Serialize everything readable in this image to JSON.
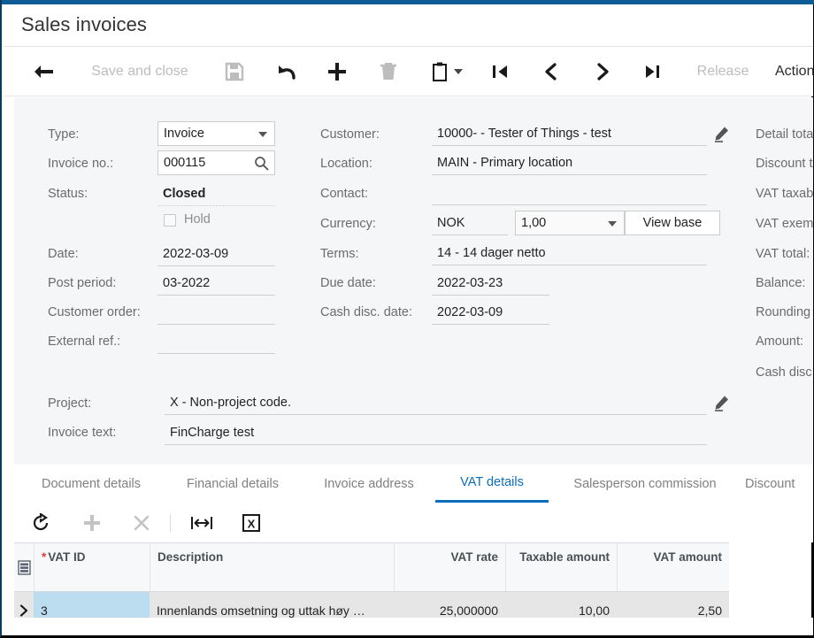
{
  "window": {
    "page_title": "Sales invoices",
    "accent_color": "#0a6ebd",
    "topbar_color": "#0f5b96"
  },
  "toolbar": {
    "back_icon": "back-arrow-icon",
    "save_and_close_label": "Save and close",
    "save_icon": "save-icon",
    "undo_icon": "undo-icon",
    "add_icon": "plus-icon",
    "delete_icon": "trash-icon",
    "clipboard_icon": "clipboard-icon",
    "first_icon": "first-record-icon",
    "prev_icon": "previous-record-icon",
    "next_icon": "next-record-icon",
    "last_icon": "last-record-icon",
    "release_label": "Release",
    "actions_label": "Actions"
  },
  "form": {
    "left": {
      "type_label": "Type:",
      "type_value": "Invoice",
      "invoice_no_label": "Invoice no.:",
      "invoice_no_value": "000115",
      "status_label": "Status:",
      "status_value": "Closed",
      "hold_label": "Hold",
      "date_label": "Date:",
      "date_value": "2022-03-09",
      "post_period_label": "Post period:",
      "post_period_value": "03-2022",
      "customer_order_label": "Customer order:",
      "customer_order_value": "",
      "external_ref_label": "External ref.:",
      "external_ref_value": ""
    },
    "middle": {
      "customer_label": "Customer:",
      "customer_value": "10000- - Tester of Things - test",
      "location_label": "Location:",
      "location_value": "MAIN - Primary location",
      "contact_label": "Contact:",
      "contact_value": "",
      "currency_label": "Currency:",
      "currency_value": "NOK",
      "rate_value": "1,00",
      "view_base_label": "View base",
      "terms_label": "Terms:",
      "terms_value": "14 - 14 dager netto",
      "due_date_label": "Due date:",
      "due_date_value": "2022-03-23",
      "cash_disc_date_label": "Cash disc. date:",
      "cash_disc_date_value": "2022-03-09"
    },
    "right": {
      "detail_total_label": "Detail tota",
      "discount_total_label": "Discount t",
      "vat_taxable_label": "VAT taxab",
      "vat_exempt_label": "VAT exem",
      "vat_total_label": "VAT total:",
      "balance_label": "Balance:",
      "rounding_label": "Rounding",
      "amount_label": "Amount:",
      "cash_disc_label": "Cash disc"
    },
    "bottom": {
      "project_label": "Project:",
      "project_value": "X - Non-project code.",
      "invoice_text_label": "Invoice text:",
      "invoice_text_value": "FinCharge test"
    }
  },
  "tabs": [
    {
      "label": "Document details",
      "active": false
    },
    {
      "label": "Financial details",
      "active": false
    },
    {
      "label": "Invoice address",
      "active": false
    },
    {
      "label": "VAT details",
      "active": true
    },
    {
      "label": "Salesperson commission",
      "active": false
    },
    {
      "label": "Discount",
      "active": false
    }
  ],
  "grid_toolbar": {
    "refresh_icon": "refresh-icon",
    "add_row_icon": "plus-icon",
    "delete_row_icon": "close-x-icon",
    "fit_columns_icon": "fit-columns-icon",
    "export_excel_icon": "excel-export-icon"
  },
  "grid": {
    "settings_icon": "column-settings-icon",
    "row_expand_icon": "chevron-right-icon",
    "columns": [
      {
        "label": "VAT ID",
        "required": true,
        "align": "left"
      },
      {
        "label": "Description",
        "required": false,
        "align": "left"
      },
      {
        "label": "VAT rate",
        "required": false,
        "align": "right"
      },
      {
        "label": "Taxable amount",
        "required": false,
        "align": "right"
      },
      {
        "label": "VAT amount",
        "required": false,
        "align": "right"
      }
    ],
    "rows": [
      {
        "vat_id": "3",
        "description": "Innenlands omsetning og uttak høy …",
        "vat_rate": "25,000000",
        "taxable_amount": "10,00",
        "vat_amount": "2,50"
      }
    ]
  }
}
